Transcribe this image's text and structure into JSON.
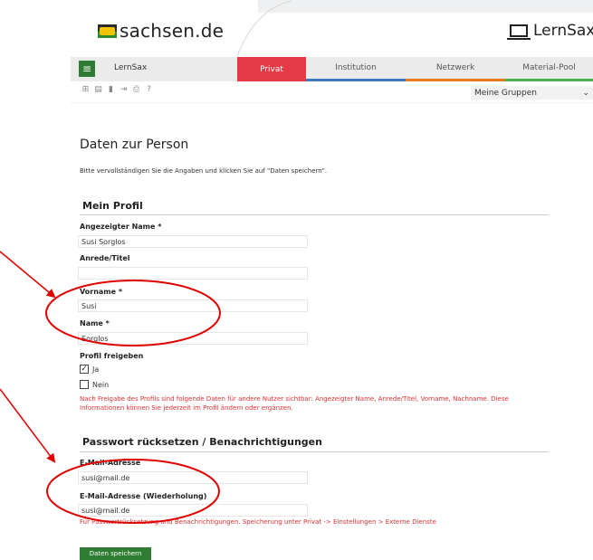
{
  "header": {
    "logo_text": "sachsen.de",
    "brand_right": "LernSax"
  },
  "nav": {
    "app_name": "LernSax",
    "tabs": [
      {
        "label": "Privat",
        "color": "#e63946"
      },
      {
        "label": "Institution",
        "color": "#3a78c2"
      },
      {
        "label": "Netzwerk",
        "color": "#e87a1d"
      },
      {
        "label": "Material-Pool",
        "color": "#4caf50"
      }
    ],
    "groups_select": "Meine Gruppen"
  },
  "page": {
    "title": "Daten zur Person",
    "intro": "Bitte vervollständigen Sie die Angaben und klicken Sie auf \"Daten speichern\"."
  },
  "profile": {
    "heading": "Mein Profil",
    "display_name_label": "Angezeigter Name *",
    "display_name_value": "Susi Sorglos",
    "title_label": "Anrede/Titel",
    "title_value": "",
    "firstname_label": "Vorname *",
    "firstname_value": "Susi",
    "lastname_label": "Name *",
    "lastname_value": "Sorglos",
    "share_label": "Profil freigeben",
    "option_yes": "Ja",
    "option_no": "Nein",
    "share_selected": "Ja",
    "share_note": "Nach Freigabe des Profils sind folgende Daten für andere Nutzer sichtbar: Angezeigter Name, Anrede/Titel, Vorname, Nachname. Diese Informationen können Sie jederzeit im Profil ändern oder ergänzen."
  },
  "password": {
    "heading": "Passwort rücksetzen / Benachrichtigungen",
    "email_label": "E-Mail-Adresse",
    "email_value": "susi@mail.de",
    "email_repeat_label": "E-Mail-Adresse (Wiederholung)",
    "email_repeat_value": "susi@mail.de",
    "note": "Für Passwortrücksetzung und Benachrichtigungen. Speicherung unter Privat -> Einstellungen > Externe Dienste"
  },
  "save_button": "Daten speichern",
  "annotation_color": "#e00000"
}
